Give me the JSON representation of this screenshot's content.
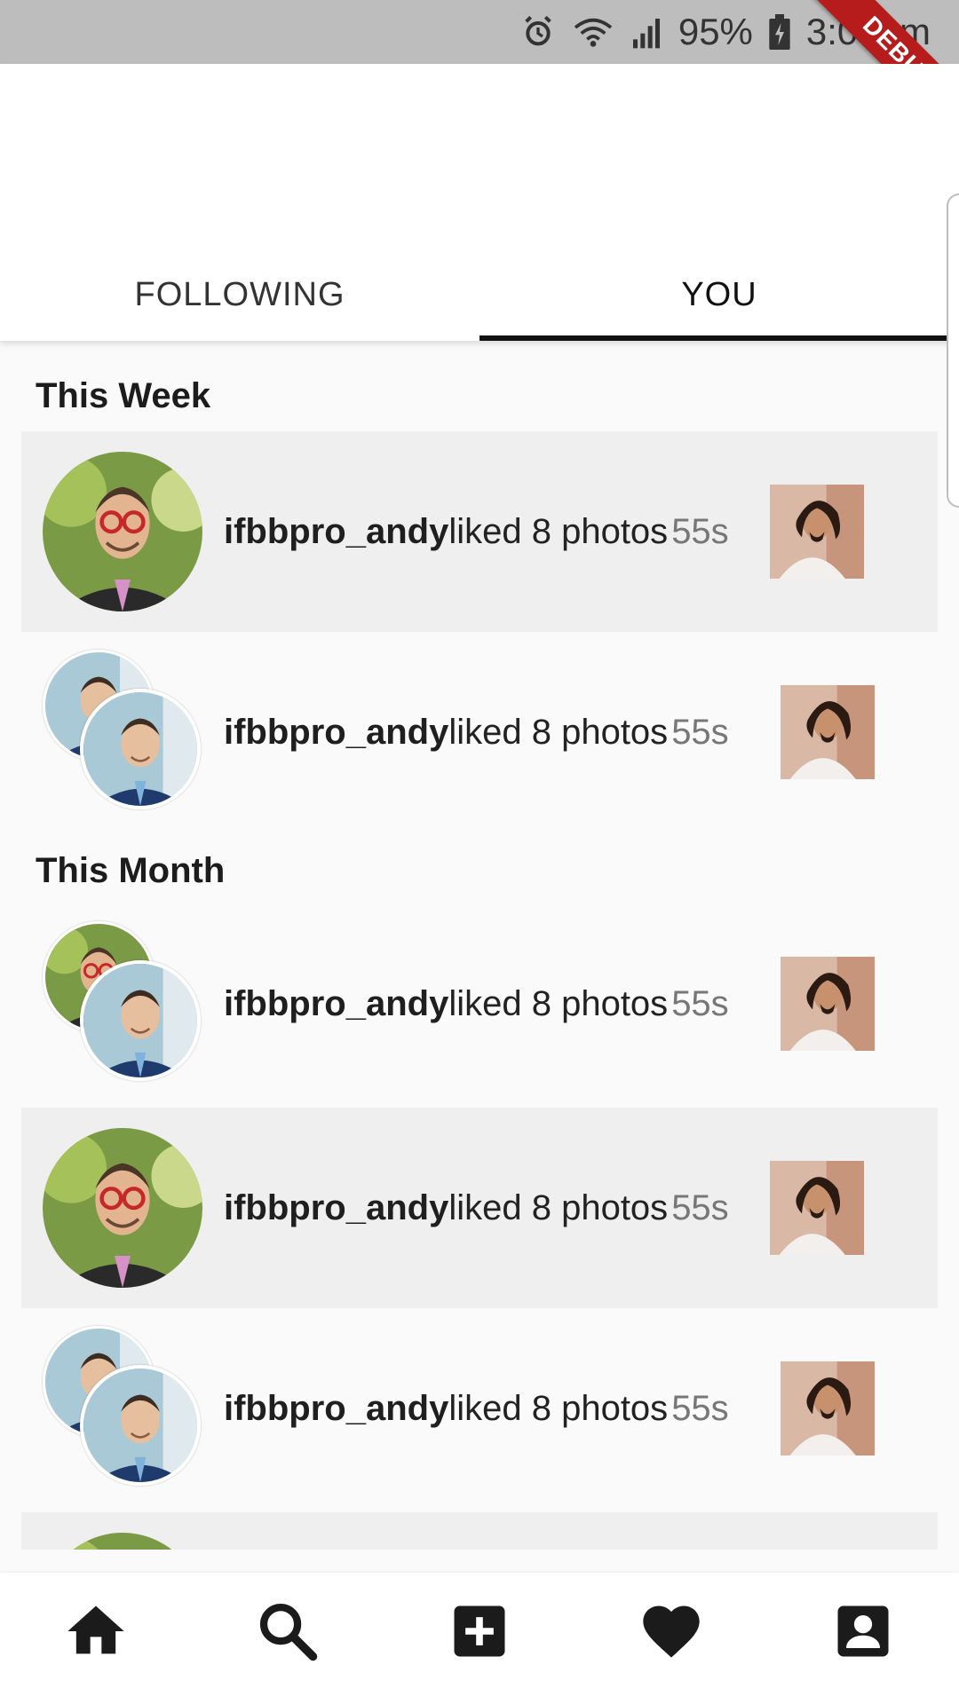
{
  "status_bar": {
    "battery": "95%",
    "time": "3:04pm",
    "icons": [
      "alarm-icon",
      "wifi-icon",
      "signal-icon",
      "battery-charging-icon"
    ]
  },
  "debug_banner": {
    "label": "DEBUG"
  },
  "tabs": [
    {
      "label": "FOLLOWING",
      "active": false
    },
    {
      "label": "YOU",
      "active": true
    }
  ],
  "sections": {
    "week": "This Week",
    "month": "This Month"
  },
  "notifications": [
    {
      "user": "ifbbpro_andy",
      "action": "liked 8 photos",
      "time": "55s",
      "highlight": true
    },
    {
      "user": "ifbbpro_andy",
      "action": "liked 8 photos",
      "time": "55s",
      "highlight": false
    },
    {
      "user": "ifbbpro_andy",
      "action": "liked 8 photos",
      "time": "55s",
      "highlight": false
    },
    {
      "user": "ifbbpro_andy",
      "action": "liked 8 photos",
      "time": "55s",
      "highlight": true
    },
    {
      "user": "ifbbpro_andy",
      "action": "liked 8 photos",
      "time": "55s",
      "highlight": false
    }
  ],
  "bottom_nav": [
    {
      "icon": "home-icon"
    },
    {
      "icon": "search-icon"
    },
    {
      "icon": "add-box-icon"
    },
    {
      "icon": "heart-icon"
    },
    {
      "icon": "account-box-icon"
    }
  ],
  "colors": {
    "status_bar_bg": "#bdbdbd",
    "debug_ribbon": "#b71c1c",
    "highlight_row": "#efefef",
    "tab_indicator": "#111111",
    "page_bg": "#fafafa"
  }
}
